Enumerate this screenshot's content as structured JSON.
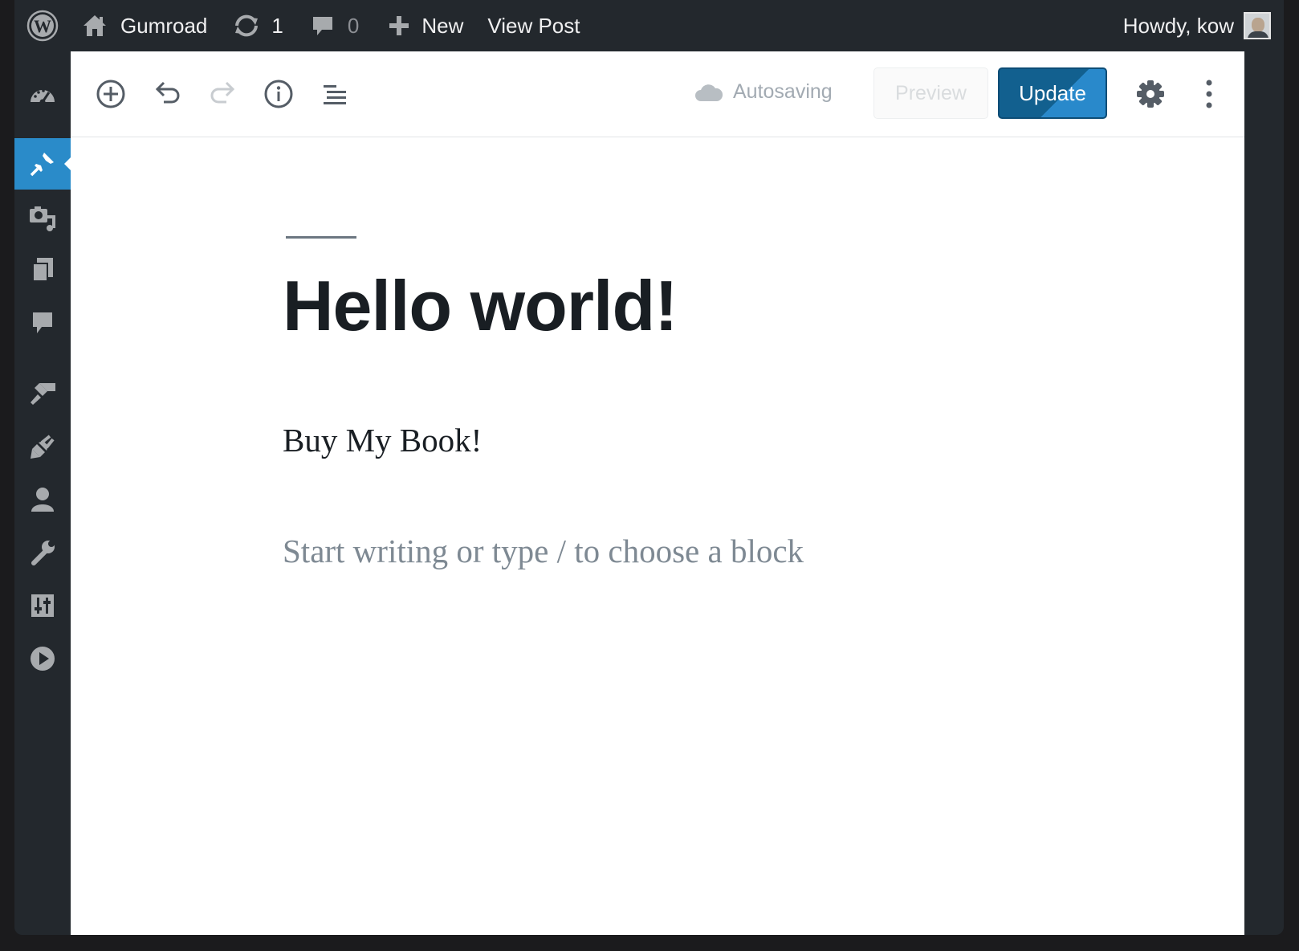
{
  "adminbar": {
    "site_name": "Gumroad",
    "updates_count": "1",
    "comments_count": "0",
    "new_label": "New",
    "view_post_label": "View Post",
    "greeting": "Howdy, kow"
  },
  "sidebar": {
    "items": [
      {
        "name": "dashboard",
        "icon": "dashboard-icon"
      },
      {
        "name": "posts",
        "icon": "pin-icon",
        "active": true
      },
      {
        "name": "media",
        "icon": "media-icon"
      },
      {
        "name": "pages",
        "icon": "pages-icon"
      },
      {
        "name": "comments",
        "icon": "comment-icon"
      },
      {
        "name": "appearance",
        "icon": "paintbrush-icon"
      },
      {
        "name": "plugins",
        "icon": "plugin-icon"
      },
      {
        "name": "users",
        "icon": "user-icon"
      },
      {
        "name": "tools",
        "icon": "wrench-icon"
      },
      {
        "name": "settings",
        "icon": "settings-sliders-icon"
      },
      {
        "name": "media-player",
        "icon": "play-icon"
      }
    ]
  },
  "toolbar": {
    "autosave_label": "Autosaving",
    "preview_label": "Preview",
    "update_label": "Update"
  },
  "post": {
    "title": "Hello world!",
    "paragraph": "Buy My Book!",
    "placeholder": "Start writing or type / to choose a block"
  },
  "colors": {
    "admin_bg": "#23282d",
    "accent": "#2a8bc9",
    "update_button": "#12608f"
  }
}
